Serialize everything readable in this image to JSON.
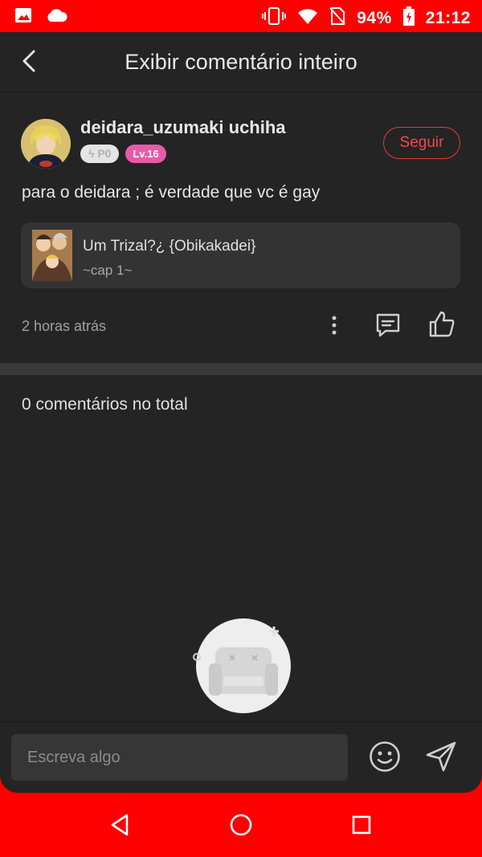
{
  "status_bar": {
    "battery": "94%",
    "time": "21:12",
    "icons": [
      "image-icon",
      "cloud-icon",
      "vibrate-icon",
      "wifi-icon",
      "no-sim-icon",
      "battery-charging-icon"
    ]
  },
  "header": {
    "title": "Exibir comentário inteiro"
  },
  "post": {
    "username": "deidara_uzumaki uchiha",
    "badge_points": "P0",
    "badge_level": "Lv.16",
    "follow_label": "Seguir",
    "text": "para o deidara ; é verdade que vc é gay",
    "card": {
      "title": "Um Trizal?¿ {Obikakadei}",
      "subtitle": "~cap 1~"
    },
    "timestamp": "2 horas atrás"
  },
  "comments": {
    "total_label": "0 comentários no total"
  },
  "composer": {
    "placeholder": "Escreva algo"
  },
  "colors": {
    "brand_red": "#ff0000",
    "accent_red": "#ee4a4a",
    "level_pink": "#e85aa9",
    "background": "#242424"
  }
}
